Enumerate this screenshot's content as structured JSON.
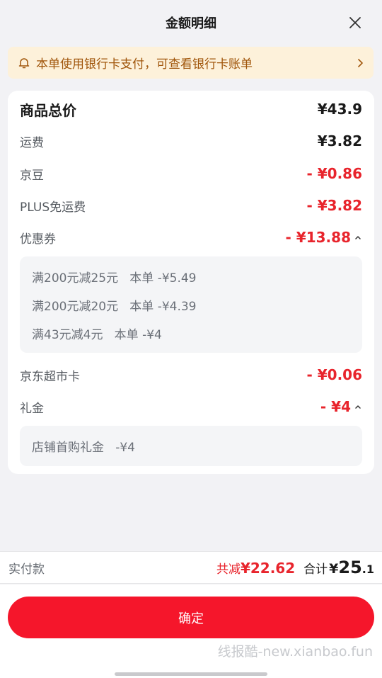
{
  "header": {
    "title": "金额明细"
  },
  "notice": {
    "text": "本单使用银行卡支付，可查看银行卡账单"
  },
  "details": {
    "total": {
      "label": "商品总价",
      "value": "¥43.9"
    },
    "shipping": {
      "label": "运费",
      "value": "¥3.82"
    },
    "jingdou": {
      "label": "京豆",
      "value": "- ¥0.86"
    },
    "plus": {
      "label": "PLUS免运费",
      "value": "- ¥3.82"
    },
    "coupon": {
      "label": "优惠券",
      "value": "- ¥13.88",
      "items": [
        "满200元减25元   本单 -¥5.49",
        "满200元减20元   本单 -¥4.39",
        "满43元减4元   本单 -¥4"
      ]
    },
    "market_card": {
      "label": "京东超市卡",
      "value": "- ¥0.06"
    },
    "gift": {
      "label": "礼金",
      "value": "- ¥4",
      "items": [
        "店铺首购礼金   -¥4"
      ]
    }
  },
  "footer": {
    "paid_label": "实付款",
    "reduce_label": "共减",
    "reduce_value": "¥22.62",
    "sum_label": "合计",
    "sum_yen": "¥",
    "sum_int": "25",
    "sum_dec": ".1"
  },
  "confirm_label": "确定",
  "watermark": "线报酷-new.xianbao.fun",
  "icons": {
    "notice": "bell-icon",
    "close": "close-icon",
    "chevron": "chevron-right-icon",
    "collapse": "chevron-up-icon"
  },
  "colors": {
    "accent": "#f5162b",
    "discount": "#e8242c",
    "notice_bg": "#fdf1da",
    "notice_text": "#a0550a"
  }
}
